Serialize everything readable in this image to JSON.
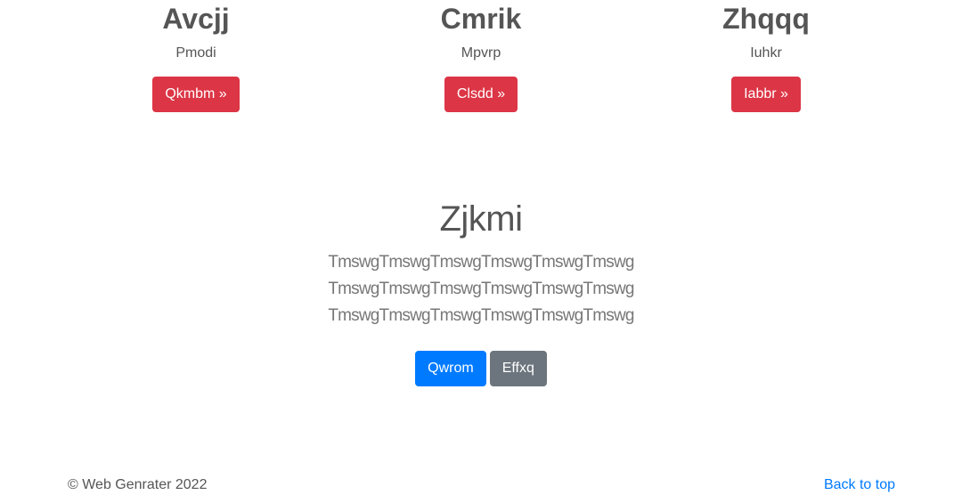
{
  "features": [
    {
      "title": "Avcjj",
      "subtitle": "Pmodi",
      "button": "Qkmbm »"
    },
    {
      "title": "Cmrik",
      "subtitle": "Mpvrp",
      "button": "Clsdd »"
    },
    {
      "title": "Zhqqq",
      "subtitle": "Iuhkr",
      "button": "Iabbr »"
    }
  ],
  "hero": {
    "title": "Zjkmi",
    "lines": [
      "TmswgTmswgTmswgTmswgTmswgTmswg",
      "TmswgTmswgTmswgTmswgTmswgTmswg",
      "TmswgTmswgTmswgTmswgTmswgTmswg"
    ],
    "primary_button": "Qwrom",
    "secondary_button": "Effxq"
  },
  "footer": {
    "copyright": "© Web Genrater 2022",
    "back_to_top": "Back to top"
  },
  "colors": {
    "danger": "#dc3545",
    "primary": "#007bff",
    "secondary": "#6c757d",
    "text": "#555555"
  }
}
